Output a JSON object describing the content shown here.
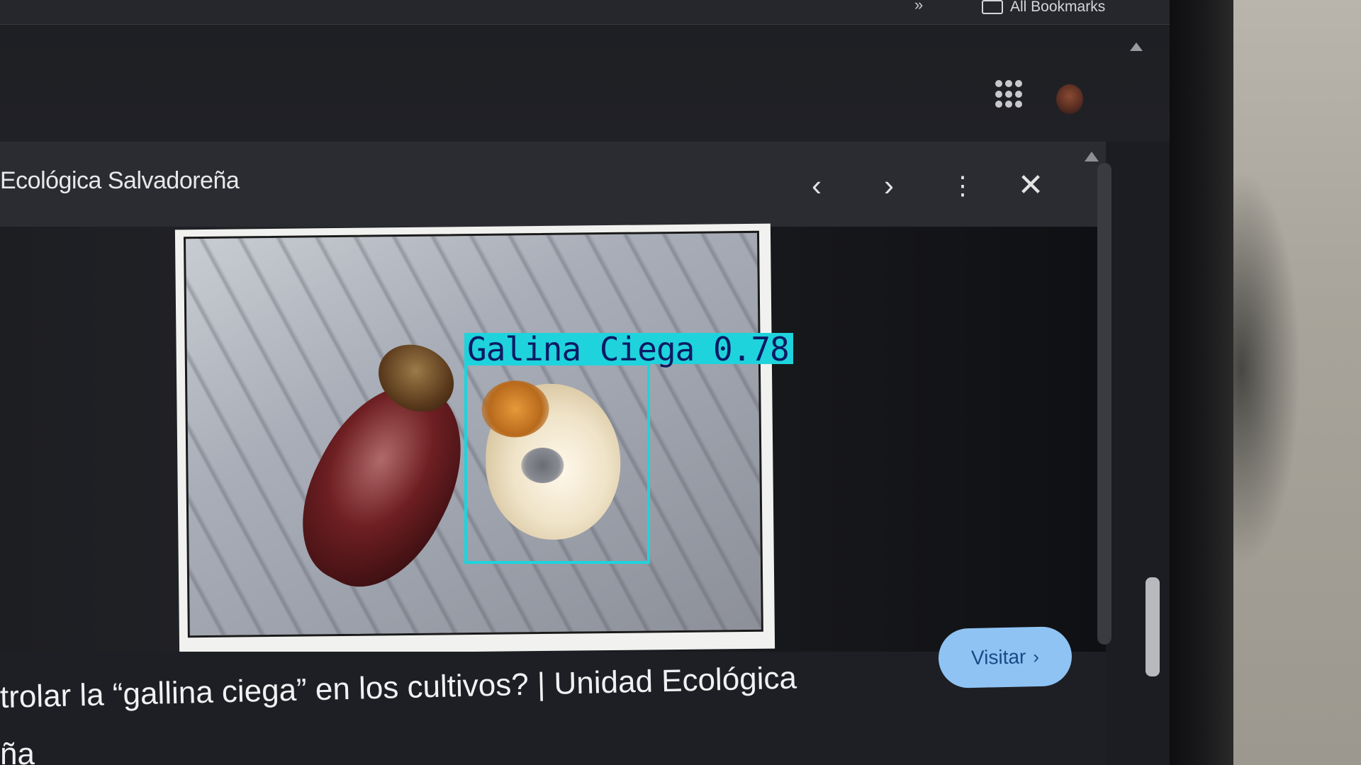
{
  "browser": {
    "bookmarks_chevron": "»",
    "all_bookmarks_label": "All Bookmarks"
  },
  "header": {
    "apps_icon": "apps-grid-icon",
    "avatar": "user-avatar"
  },
  "viewer": {
    "source_title": "Ecológica Salvadoreña",
    "controls": {
      "prev": "‹",
      "next": "›",
      "more": "⋮",
      "close": "✕"
    },
    "image": {
      "detection_label": "Galina Ciega 0.78",
      "detection_color": "#1fd3dc"
    },
    "caption_line1": "trolar la “gallina ciega” en los cultivos? | Unidad Ecológica",
    "caption_line2": "ña",
    "visit_button": {
      "label": "Visitar",
      "chevron": "›"
    }
  },
  "colors": {
    "accent": "#8fc3f4",
    "background": "#1c1d22"
  }
}
